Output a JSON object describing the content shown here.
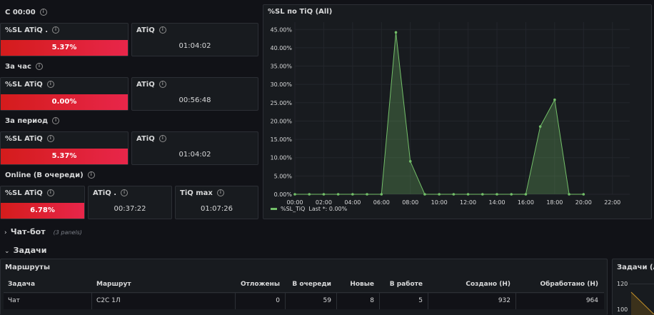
{
  "sections": {
    "s1": "С 00:00",
    "s2": "За час",
    "s3": "За период",
    "s4": "Online (В очереди)"
  },
  "stats": {
    "p1": {
      "sl_title": "%SL ATiQ .",
      "sl_value": "5.37%",
      "atiq_title": "ATiQ",
      "atiq_value": "01:04:02"
    },
    "p2": {
      "sl_title": "%SL ATiQ",
      "sl_value": "0.00%",
      "atiq_title": "ATiQ",
      "atiq_value": "00:56:48"
    },
    "p3": {
      "sl_title": "%SL ATiQ",
      "sl_value": "5.37%",
      "atiq_title": "ATiQ",
      "atiq_value": "01:04:02"
    },
    "p4": {
      "sl_title": "%SL ATiQ",
      "sl_value": "6.78%",
      "atiq_title": "ATiQ .",
      "atiq_value": "00:37:22",
      "max_title": "TiQ max",
      "max_value": "01:07:26"
    }
  },
  "chart_panel": {
    "title": "%SL по TiQ (All)",
    "legend_label": "%SL_TiQ",
    "legend_last": "Last *: 0.00%",
    "legend_color": "#73bf69"
  },
  "chart_data": {
    "type": "area",
    "title": "%SL по TiQ (All)",
    "y_ticks": [
      "0.00%",
      "5.00%",
      "10.00%",
      "15.00%",
      "20.00%",
      "25.00%",
      "30.00%",
      "35.00%",
      "40.00%",
      "45.00%"
    ],
    "x_ticks": [
      "00:00",
      "02:00",
      "04:00",
      "06:00",
      "08:00",
      "10:00",
      "12:00",
      "14:00",
      "16:00",
      "18:00",
      "20:00",
      "22:00"
    ],
    "ylim": [
      0,
      47
    ],
    "xlim_hours": [
      0,
      23.2
    ],
    "series": [
      {
        "name": "%SL_TiQ",
        "color": "#73bf69",
        "x_hours": [
          0,
          1,
          2,
          3,
          4,
          5,
          6,
          7,
          8,
          9,
          10,
          11,
          12,
          13,
          14,
          15,
          16,
          17,
          18,
          19,
          20
        ],
        "values": [
          0,
          0,
          0,
          0,
          0,
          0,
          0,
          44.2,
          9,
          0,
          0,
          0,
          0,
          0,
          0,
          0,
          0,
          18.5,
          25.8,
          0,
          0
        ]
      }
    ]
  },
  "rows": {
    "chatbot": {
      "title": "Чат-бот",
      "note": "(3 panels)"
    },
    "tasks": {
      "title": "Задачи"
    }
  },
  "routes": {
    "title": "Маршруты",
    "columns": [
      "Задача",
      "Маршрут",
      "Отложены",
      "В очереди",
      "Новые",
      "В работе",
      "Создано (Н)",
      "Обработано (Н)"
    ],
    "row": [
      "Чат",
      "C2C 1Л",
      "0",
      "59",
      "8",
      "5",
      "932",
      "964"
    ]
  },
  "tasks_panel": {
    "title": "Задачи (All",
    "y_ticks": [
      "120",
      "100"
    ]
  }
}
